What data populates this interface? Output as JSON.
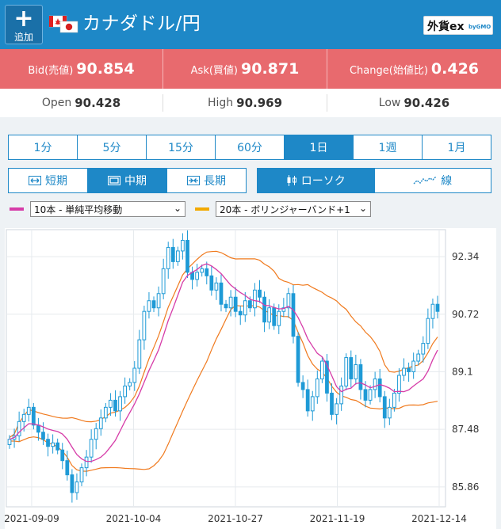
{
  "header": {
    "add_label": "追加",
    "add_symbol": "+",
    "title": "カナダドル/円",
    "logo_main": "外貨ex",
    "logo_sub": "byGMO"
  },
  "quote": {
    "bid_label": "Bid(売値)",
    "bid_value": "90.854",
    "ask_label": "Ask(買値)",
    "ask_value": "90.871",
    "change_label": "Change(始値比)",
    "change_value": "0.426"
  },
  "ohl": {
    "open_label": "Open",
    "open_value": "90.428",
    "high_label": "High",
    "high_value": "90.969",
    "low_label": "Low",
    "low_value": "90.426"
  },
  "periods": [
    "1分",
    "5分",
    "15分",
    "60分",
    "1日",
    "1週",
    "1月"
  ],
  "active_period": "1日",
  "terms": [
    "短期",
    "中期",
    "長期"
  ],
  "active_term": "中期",
  "chart_types": [
    "ローソク",
    "線"
  ],
  "active_chart_type": "ローソク",
  "indicators": {
    "primary": {
      "value": "10本 - 単純平均移動",
      "color": "#d63ca8"
    },
    "secondary": {
      "value": "20本 - ボリンジャーバンド+1",
      "color": "#f2a900"
    }
  },
  "colors": {
    "accent": "#1e88c7",
    "quote_bg": "#e86a6e",
    "candle": "#1e9ad6",
    "ma_line": "#d63ca8",
    "band_line": "#f07a1e"
  },
  "chart_data": {
    "type": "candlestick",
    "y_ticks": [
      "92.34",
      "90.72",
      "89.1",
      "87.48",
      "85.86"
    ],
    "x_ticks": [
      "2021-09-09",
      "2021-10-04",
      "2021-10-27",
      "2021-11-19",
      "2021-12-14"
    ],
    "ylim": [
      85.3,
      93.1
    ],
    "grid": true,
    "closes": [
      87.2,
      87.3,
      87.7,
      87.9,
      88.1,
      87.6,
      87.4,
      87.2,
      87.0,
      87.1,
      86.9,
      86.6,
      86.2,
      85.7,
      86.0,
      86.4,
      86.7,
      87.2,
      87.5,
      87.8,
      88.1,
      88.3,
      88.0,
      88.4,
      88.7,
      88.8,
      89.2,
      90.0,
      90.8,
      91.1,
      90.9,
      91.3,
      92.0,
      92.6,
      92.2,
      92.5,
      92.8,
      91.9,
      91.7,
      91.9,
      92.0,
      91.8,
      91.4,
      91.6,
      91.0,
      90.9,
      91.2,
      90.8,
      90.7,
      91.1,
      90.9,
      91.4,
      91.2,
      90.5,
      90.9,
      90.4,
      90.8,
      90.9,
      91.3,
      90.1,
      88.8,
      88.6,
      88.0,
      88.4,
      88.9,
      89.4,
      88.5,
      87.9,
      88.2,
      88.7,
      89.5,
      88.9,
      89.3,
      88.6,
      88.3,
      88.6,
      88.9,
      88.4,
      87.8,
      88.1,
      88.5,
      89.0,
      89.2,
      89.1,
      89.4,
      89.6,
      89.9,
      90.6,
      91.0,
      90.8
    ]
  }
}
